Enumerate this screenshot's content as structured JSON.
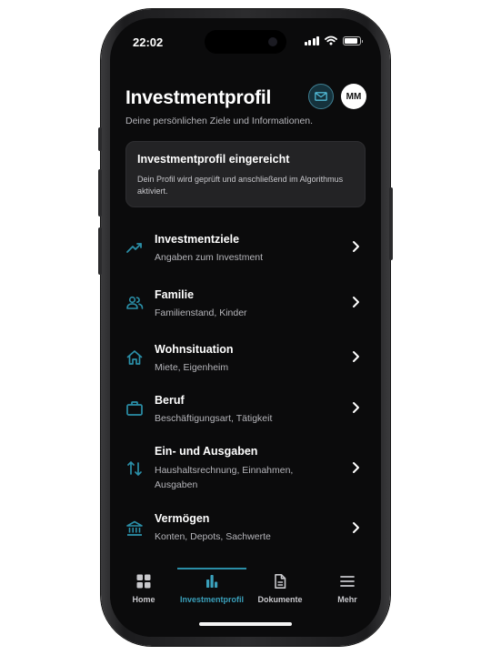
{
  "status_bar": {
    "time": "22:02"
  },
  "header": {
    "title": "Investmentprofil",
    "subtitle": "Deine persönlichen Ziele und Informationen.",
    "avatar_initials": "MM",
    "mail_icon": "envelope-icon"
  },
  "status_card": {
    "title": "Investmentprofil eingereicht",
    "text": "Dein Profil wird geprüft und anschließend im Algorithmus aktiviert."
  },
  "menu": {
    "items": [
      {
        "title": "Investmentziele",
        "subtitle": "Angaben zum Investment",
        "icon": "trending-up-icon"
      },
      {
        "title": "Familie",
        "subtitle": "Familienstand, Kinder",
        "icon": "people-icon"
      },
      {
        "title": "Wohnsituation",
        "subtitle": "Miete, Eigenheim",
        "icon": "house-icon"
      },
      {
        "title": "Beruf",
        "subtitle": "Beschäftigungsart, Tätigkeit",
        "icon": "briefcase-icon"
      },
      {
        "title": "Ein- und Ausgaben",
        "subtitle": "Haushaltsrechnung, Einnahmen, Ausgaben",
        "icon": "swap-vertical-icon"
      },
      {
        "title": "Vermögen",
        "subtitle": "Konten, Depots, Sachwerte",
        "icon": "bank-icon"
      }
    ]
  },
  "tab_bar": {
    "active_tab": "Investmentprofil",
    "tabs": [
      {
        "label": "Home",
        "icon": "grid-icon"
      },
      {
        "label": "Investmentprofil",
        "icon": "bar-chart-icon"
      },
      {
        "label": "Dokumente",
        "icon": "document-icon"
      },
      {
        "label": "Mehr",
        "icon": "hamburger-menu-icon"
      }
    ]
  },
  "colors": {
    "background": "#0b0b0c",
    "accent": "#3aa0bb",
    "card": "#232325",
    "text_secondary": "#b5b5ba"
  }
}
